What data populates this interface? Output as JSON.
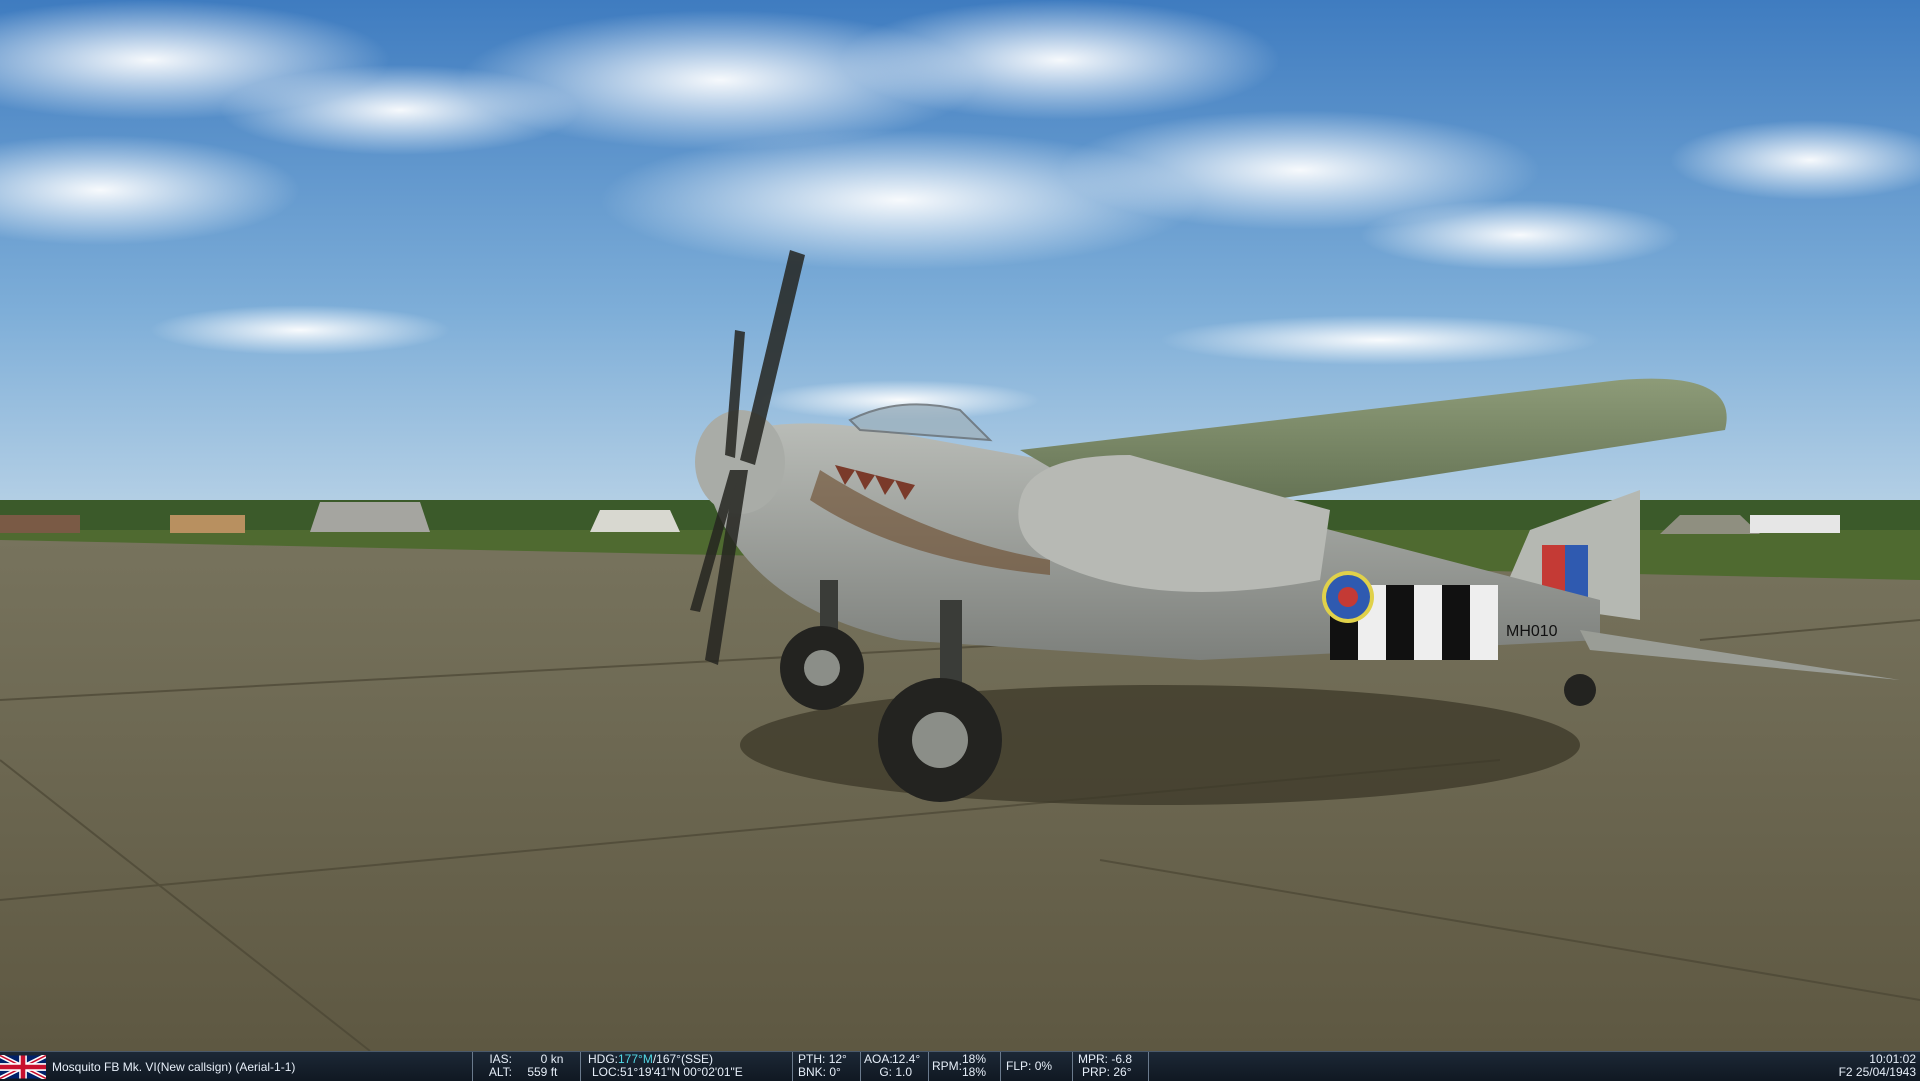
{
  "aircraft": {
    "name": "Mosquito FB Mk. VI(New callsign) (Aerial-1-1)",
    "marking_code": "MH010",
    "flag_icon": "union-jack-icon"
  },
  "hud": {
    "ias_label": "IAS:",
    "ias_value": "0",
    "ias_unit": "kn",
    "alt_label": "ALT:",
    "alt_value": "559",
    "alt_unit": "ft",
    "hdg_label": "HDG:",
    "hdg_magnetic": "177°M",
    "hdg_true": "/167°(SSE)",
    "loc_label": "LOC:",
    "loc_value": "51°19'41\"N 00°02'01\"E",
    "pth_label": "PTH:",
    "pth_value": "12°",
    "bnk_label": "BNK:",
    "bnk_value": "0°",
    "aoa_label": "AOA:",
    "aoa_value": "12.4°",
    "g_label": "G:",
    "g_value": "1.0",
    "rpm_label": "RPM:",
    "rpm_value_1": "18%",
    "rpm_value_2": "18%",
    "flp_label": "FLP:",
    "flp_value": "0%",
    "mpr_label": "MPR:",
    "mpr_value": "-6.8",
    "prp_label": "PRP:",
    "prp_value": "26°"
  },
  "clock": {
    "time": "10:01:02",
    "date": "F2 25/04/1943"
  },
  "colors": {
    "status_bar_bg": "#142030",
    "heading_magnetic": "#52d9e6",
    "sky_top": "#4d84c4",
    "tarmac": "#6f6a52"
  }
}
